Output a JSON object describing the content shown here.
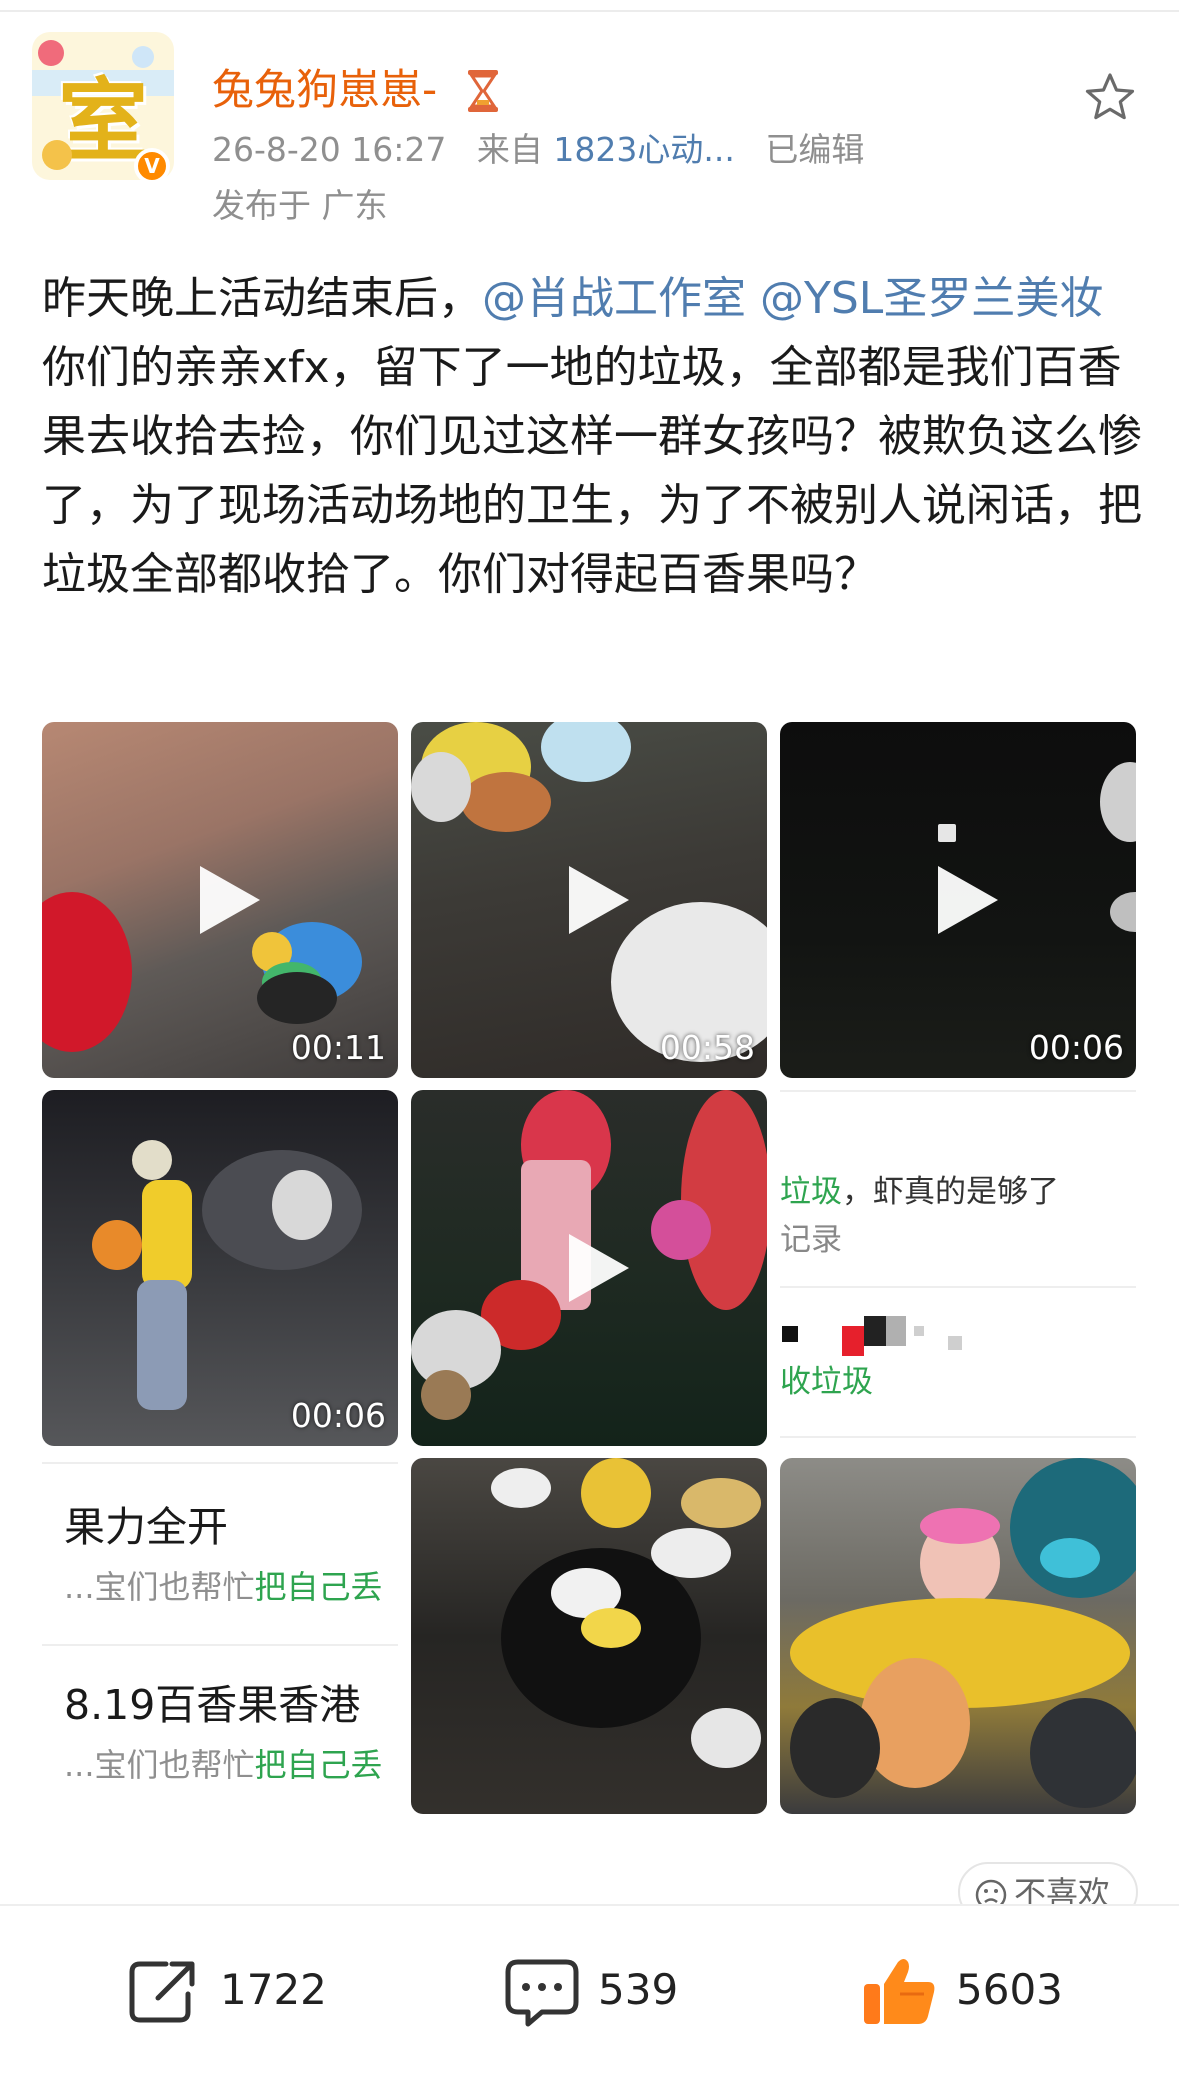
{
  "header": {
    "username": "兔兔狗崽崽-",
    "username_suffix_icon": "hourglass-icon",
    "verified_icon": "verified-badge-icon",
    "time": "26-8-20 16:27",
    "source_prefix": "来自",
    "source": "1823心动...",
    "edited": "已编辑",
    "location": "发布于 广东",
    "avatar_text": "室"
  },
  "post": {
    "text_1": "昨天晚上活动结束后，",
    "mention_1": "@肖战工作室",
    "mention_2": "@YSL圣罗兰美妆",
    "text_2": " 你们的亲亲xfx，留下了一地的垃圾，全部都是我们百香果去收拾去捡，你们见过这样一群女孩吗？被欺负这么惨了，为了现场活动场地的卫生，为了不被别人说闲话，把垃圾全部都收拾了。你们对得起百香果吗？"
  },
  "media": {
    "videos": [
      {
        "duration": "00:11"
      },
      {
        "duration": "00:58"
      },
      {
        "duration": "00:06"
      },
      {
        "duration": "00:06"
      }
    ],
    "screenshot_1": {
      "line1_green": "垃圾",
      "line1_rest": "，虾真的是够了",
      "line2": "记录",
      "line3": "收垃圾"
    },
    "screenshot_2": {
      "item1_title": "果力全开",
      "item1_sub": "...宝们也帮忙",
      "item1_sub_green": "把自己丢",
      "item2_title": "8.19百香果香港",
      "item2_sub": "...宝们也帮忙",
      "item2_sub_green": "把自己丢"
    }
  },
  "dislike_label": "不喜欢",
  "actions": {
    "share_count": "1722",
    "comment_count": "539",
    "like_count": "5603"
  },
  "colors": {
    "username": "#e8610a",
    "link": "#507daf",
    "meta": "#8f8f8f",
    "green": "#2ea44f",
    "like": "#ff8a1a"
  }
}
